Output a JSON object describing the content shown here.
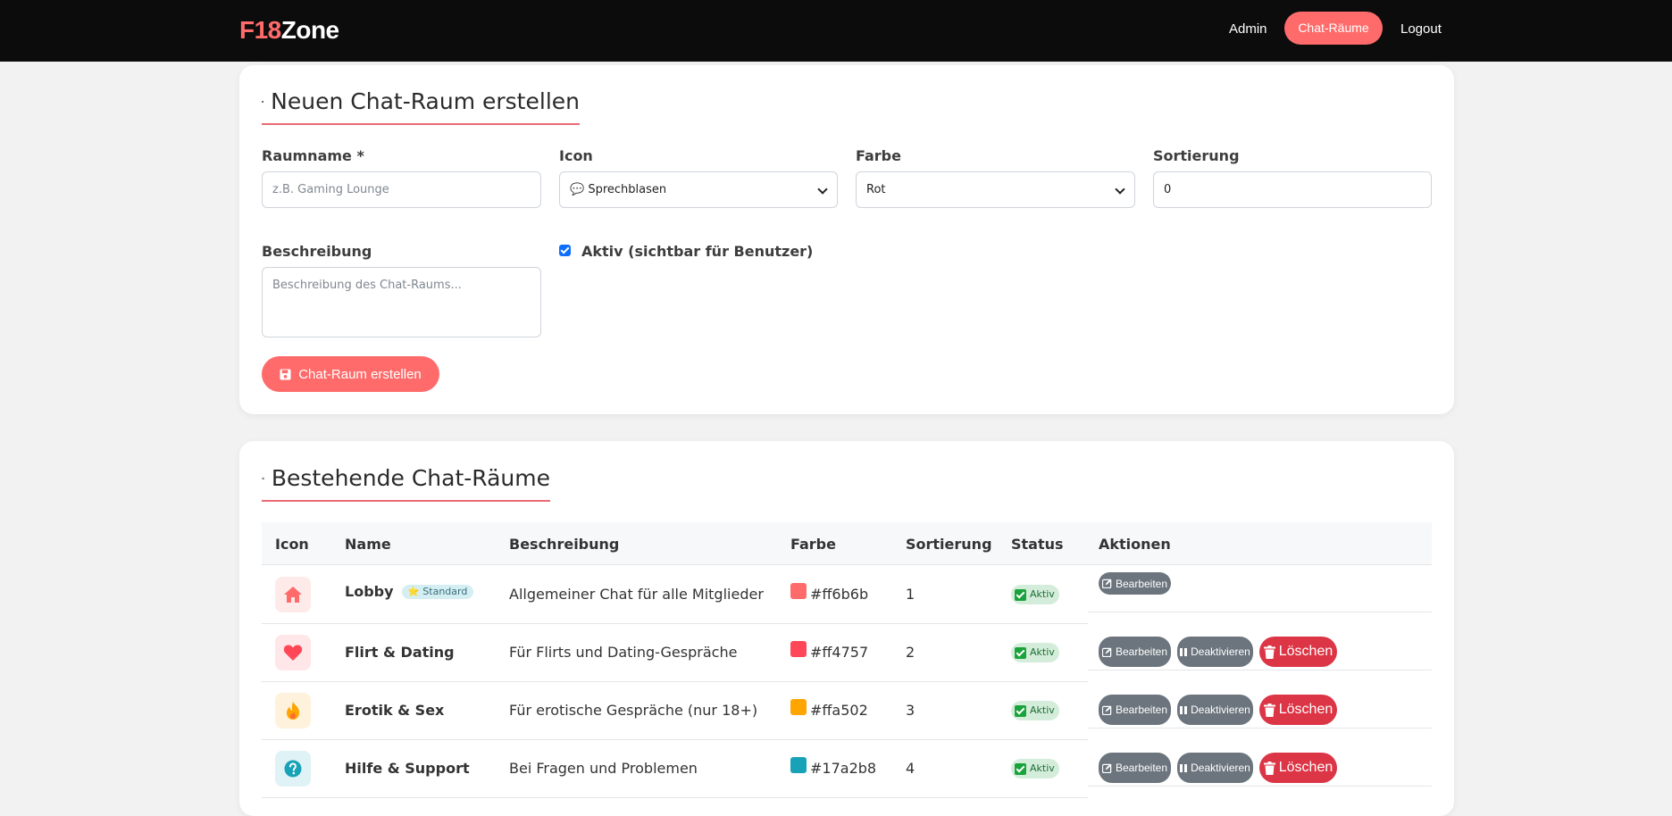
{
  "nav": {
    "brand_prefix": "F18",
    "brand_suffix": "Zone",
    "links": [
      "Admin",
      "Chat-Räume",
      "Logout"
    ],
    "active": "Chat-Räume"
  },
  "create_form": {
    "title": "Neuen Chat-Raum erstellen",
    "name_label": "Raumname *",
    "name_placeholder": "z.B. Gaming Lounge",
    "icon_label": "Icon",
    "icon_value": "💬 Sprechblasen",
    "color_label": "Farbe",
    "color_value": "Rot",
    "sort_label": "Sortierung",
    "sort_value": "0",
    "desc_label": "Beschreibung",
    "desc_placeholder": "Beschreibung des Chat-Raums...",
    "active_label": "Aktiv (sichtbar für Benutzer)",
    "active_checked": true,
    "submit_label": "Chat-Raum erstellen"
  },
  "list": {
    "title": "Bestehende Chat-Räume",
    "headers": [
      "Icon",
      "Name",
      "Beschreibung",
      "Farbe",
      "Sortierung",
      "Status",
      "Aktionen"
    ],
    "rows": [
      {
        "icon": "house-icon",
        "name": "Lobby",
        "badge": "⭐ Standard",
        "description": "Allgemeiner Chat für alle Mitglieder",
        "color": "#ff6b6b",
        "sort": "1",
        "status": "Aktiv",
        "edit": "Bearbeiten"
      },
      {
        "icon": "heart-icon",
        "name": "Flirt & Dating",
        "description": "Für Flirts und Dating-Gespräche",
        "color": "#ff4757",
        "sort": "2",
        "status": "Aktiv",
        "edit": "Bearbeiten",
        "deactivate": "Deaktivieren",
        "delete": "Löschen"
      },
      {
        "icon": "fire-icon",
        "name": "Erotik & Sex",
        "description": "Für erotische Gespräche (nur 18+)",
        "color": "#ffa502",
        "sort": "3",
        "status": "Aktiv",
        "edit": "Bearbeiten",
        "deactivate": "Deaktivieren",
        "delete": "Löschen"
      },
      {
        "icon": "question-icon",
        "name": "Hilfe & Support",
        "description": "Bei Fragen und Problemen",
        "color": "#17a2b8",
        "sort": "4",
        "status": "Aktiv",
        "edit": "Bearbeiten",
        "deactivate": "Deaktivieren",
        "delete": "Löschen"
      }
    ]
  },
  "colors": {
    "accent": "#ff6b6b",
    "navbar_bg": "#0c0c0c",
    "danger": "#dc3545",
    "secondary": "#6c757d",
    "checkbox": "#0d6efd"
  }
}
